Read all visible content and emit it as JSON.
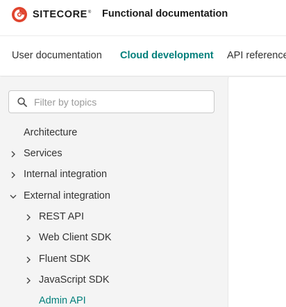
{
  "header": {
    "brand": "SITECORE",
    "brand_mark": "®",
    "site_title": "Functional documentation",
    "logo_color": "#e0442e"
  },
  "topnav": {
    "tabs": [
      {
        "label": "User documentation",
        "active": false
      },
      {
        "label": "Cloud development",
        "active": true
      },
      {
        "label": "API reference",
        "active": false
      }
    ],
    "accent_color": "#007f7b"
  },
  "sidebar": {
    "search": {
      "placeholder": "Filter by topics",
      "value": "",
      "icon": "search-icon"
    },
    "tree": [
      {
        "label": "Architecture",
        "expander": "none"
      },
      {
        "label": "Services",
        "expander": "chevron-right-icon"
      },
      {
        "label": "Internal integration",
        "expander": "chevron-right-icon"
      },
      {
        "label": "External integration",
        "expander": "chevron-down-icon",
        "children": [
          {
            "label": "REST API",
            "expander": "chevron-right-icon"
          },
          {
            "label": "Web Client SDK",
            "expander": "chevron-right-icon"
          },
          {
            "label": "Fluent SDK",
            "expander": "chevron-right-icon"
          },
          {
            "label": "JavaScript SDK",
            "expander": "chevron-right-icon"
          },
          {
            "label": "Admin API",
            "expander": "none",
            "active": true
          }
        ]
      }
    ]
  }
}
